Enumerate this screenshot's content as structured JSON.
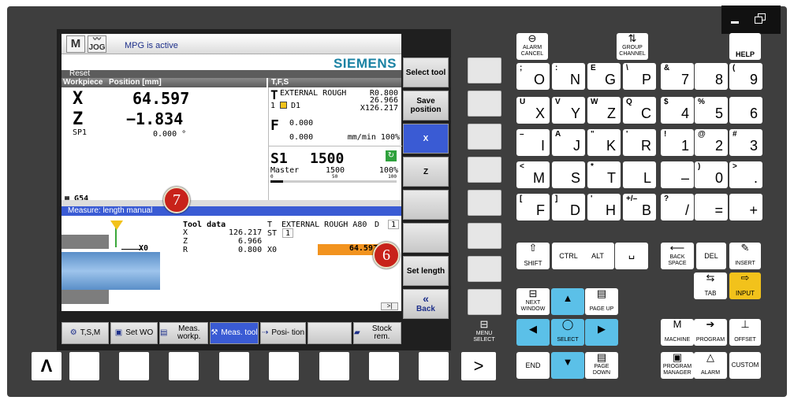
{
  "status": {
    "mode": "JOG",
    "mpg": "MPG is active",
    "brand": "SIEMENS"
  },
  "reset": "Reset",
  "wcs": {
    "col1": "Workpiece",
    "col2": "Position [mm]",
    "axes": [
      {
        "name": "X",
        "value": "64.597"
      },
      {
        "name": "Z",
        "value": "−1.834"
      }
    ],
    "sp_name": "SP1",
    "sp_value": "0.000 °",
    "offset": "G54"
  },
  "tfs": {
    "header": "T,F,S",
    "tool": "EXTERNAL ROUGH",
    "r_label": "R0.800",
    "r2": "26.966",
    "x_value": "X126.217",
    "d": "1",
    "d1": "D1",
    "f_label": "F",
    "f1": "0.000",
    "f2": "0.000",
    "f_unit": "mm/min 100%",
    "s_label": "S1",
    "s_value": "1500",
    "master": "Master",
    "master_val": "1500",
    "master_pct": "100%",
    "scale0": "0",
    "scale50": "50",
    "scale100": "100"
  },
  "measure_title": "Measure: length manual",
  "tooldata": {
    "title": "Tool data",
    "t_label": "T",
    "tool_name": "EXTERNAL ROUGH A80",
    "d_label": "D",
    "d_value": "1",
    "x_label": "X",
    "x_value": "126.217",
    "st_label": "ST",
    "st_value": "1",
    "z_label": "Z",
    "z_value": "6.966",
    "r_label": "R",
    "r_value": "0.800",
    "x0_label": "X0",
    "x0_value": "64.597",
    "axis_label": "X0"
  },
  "vsoft": [
    "Select tool",
    "Save position",
    "X",
    "Z",
    "",
    "",
    "Set length",
    "Back"
  ],
  "hsoft": [
    "T,S,M",
    "Set WO",
    "Meas. workp.",
    "Meas. tool",
    "Posi- tion",
    "",
    "Stock rem."
  ],
  "markers": [
    "7",
    "6"
  ],
  "keys": {
    "alarm": "ALARM CANCEL",
    "group": "GROUP CHANNEL",
    "help": "HELP",
    "rows": [
      [
        {
          "s": ";",
          "m": "O"
        },
        {
          "s": ":",
          "m": "N"
        },
        {
          "s": "E",
          "m": "G"
        },
        {
          "s": "\\",
          "m": "P"
        }
      ],
      [
        {
          "s": "U",
          "m": "X"
        },
        {
          "s": "V",
          "m": "Y"
        },
        {
          "s": "W",
          "m": "Z"
        },
        {
          "s": "Q",
          "m": "C"
        }
      ],
      [
        {
          "s": "–",
          "m": "I"
        },
        {
          "s": "A",
          "m": "J"
        },
        {
          "s": "\"",
          "m": "K"
        },
        {
          "s": "'",
          "m": "R"
        }
      ],
      [
        {
          "s": "<",
          "m": "M"
        },
        {
          "s": "",
          "m": "S"
        },
        {
          "s": "*",
          "m": "T"
        },
        {
          "s": "",
          "m": "L"
        }
      ],
      [
        {
          "s": "[",
          "m": "F"
        },
        {
          "s": "]",
          "m": "D"
        },
        {
          "s": "'",
          "m": "H"
        },
        {
          "s": "+/–",
          "m": "B"
        }
      ]
    ],
    "num": [
      [
        {
          "s": "&",
          "m": "7"
        },
        {
          "s": "",
          "m": "8"
        },
        {
          "s": "(",
          "m": "9"
        }
      ],
      [
        {
          "s": "$",
          "m": "4"
        },
        {
          "s": "%",
          "m": "5"
        },
        {
          "s": "",
          "m": "6"
        }
      ],
      [
        {
          "s": "!",
          "m": "1"
        },
        {
          "s": "@",
          "m": "2"
        },
        {
          "s": "#",
          "m": "3"
        }
      ],
      [
        {
          "s": "",
          "m": "–"
        },
        {
          "s": ")",
          "m": "0"
        },
        {
          "s": ">",
          "m": "."
        }
      ],
      [
        {
          "s": "?",
          "m": "/"
        },
        {
          "s": "",
          "m": "="
        },
        {
          "s": "",
          "m": "+"
        }
      ]
    ],
    "shift": "SHIFT",
    "ctrl": "CTRL",
    "alt": "ALT",
    "backspace": "BACK SPACE",
    "del": "DEL",
    "insert": "INSERT",
    "tab": "TAB",
    "input": "INPUT",
    "next_window": "NEXT WINDOW",
    "page_up": "PAGE UP",
    "page_down": "PAGE DOWN",
    "end": "END",
    "select": "SELECT",
    "menu_select": "MENU SELECT",
    "machine": "MACHINE",
    "program": "PROGRAM",
    "offset": "OFFSET",
    "prog_manager": "PROGRAM MANAGER",
    "alarm2": "ALARM",
    "custom": "CUSTOM",
    "up_arrow": "Λ",
    "next_arrow": ">"
  }
}
